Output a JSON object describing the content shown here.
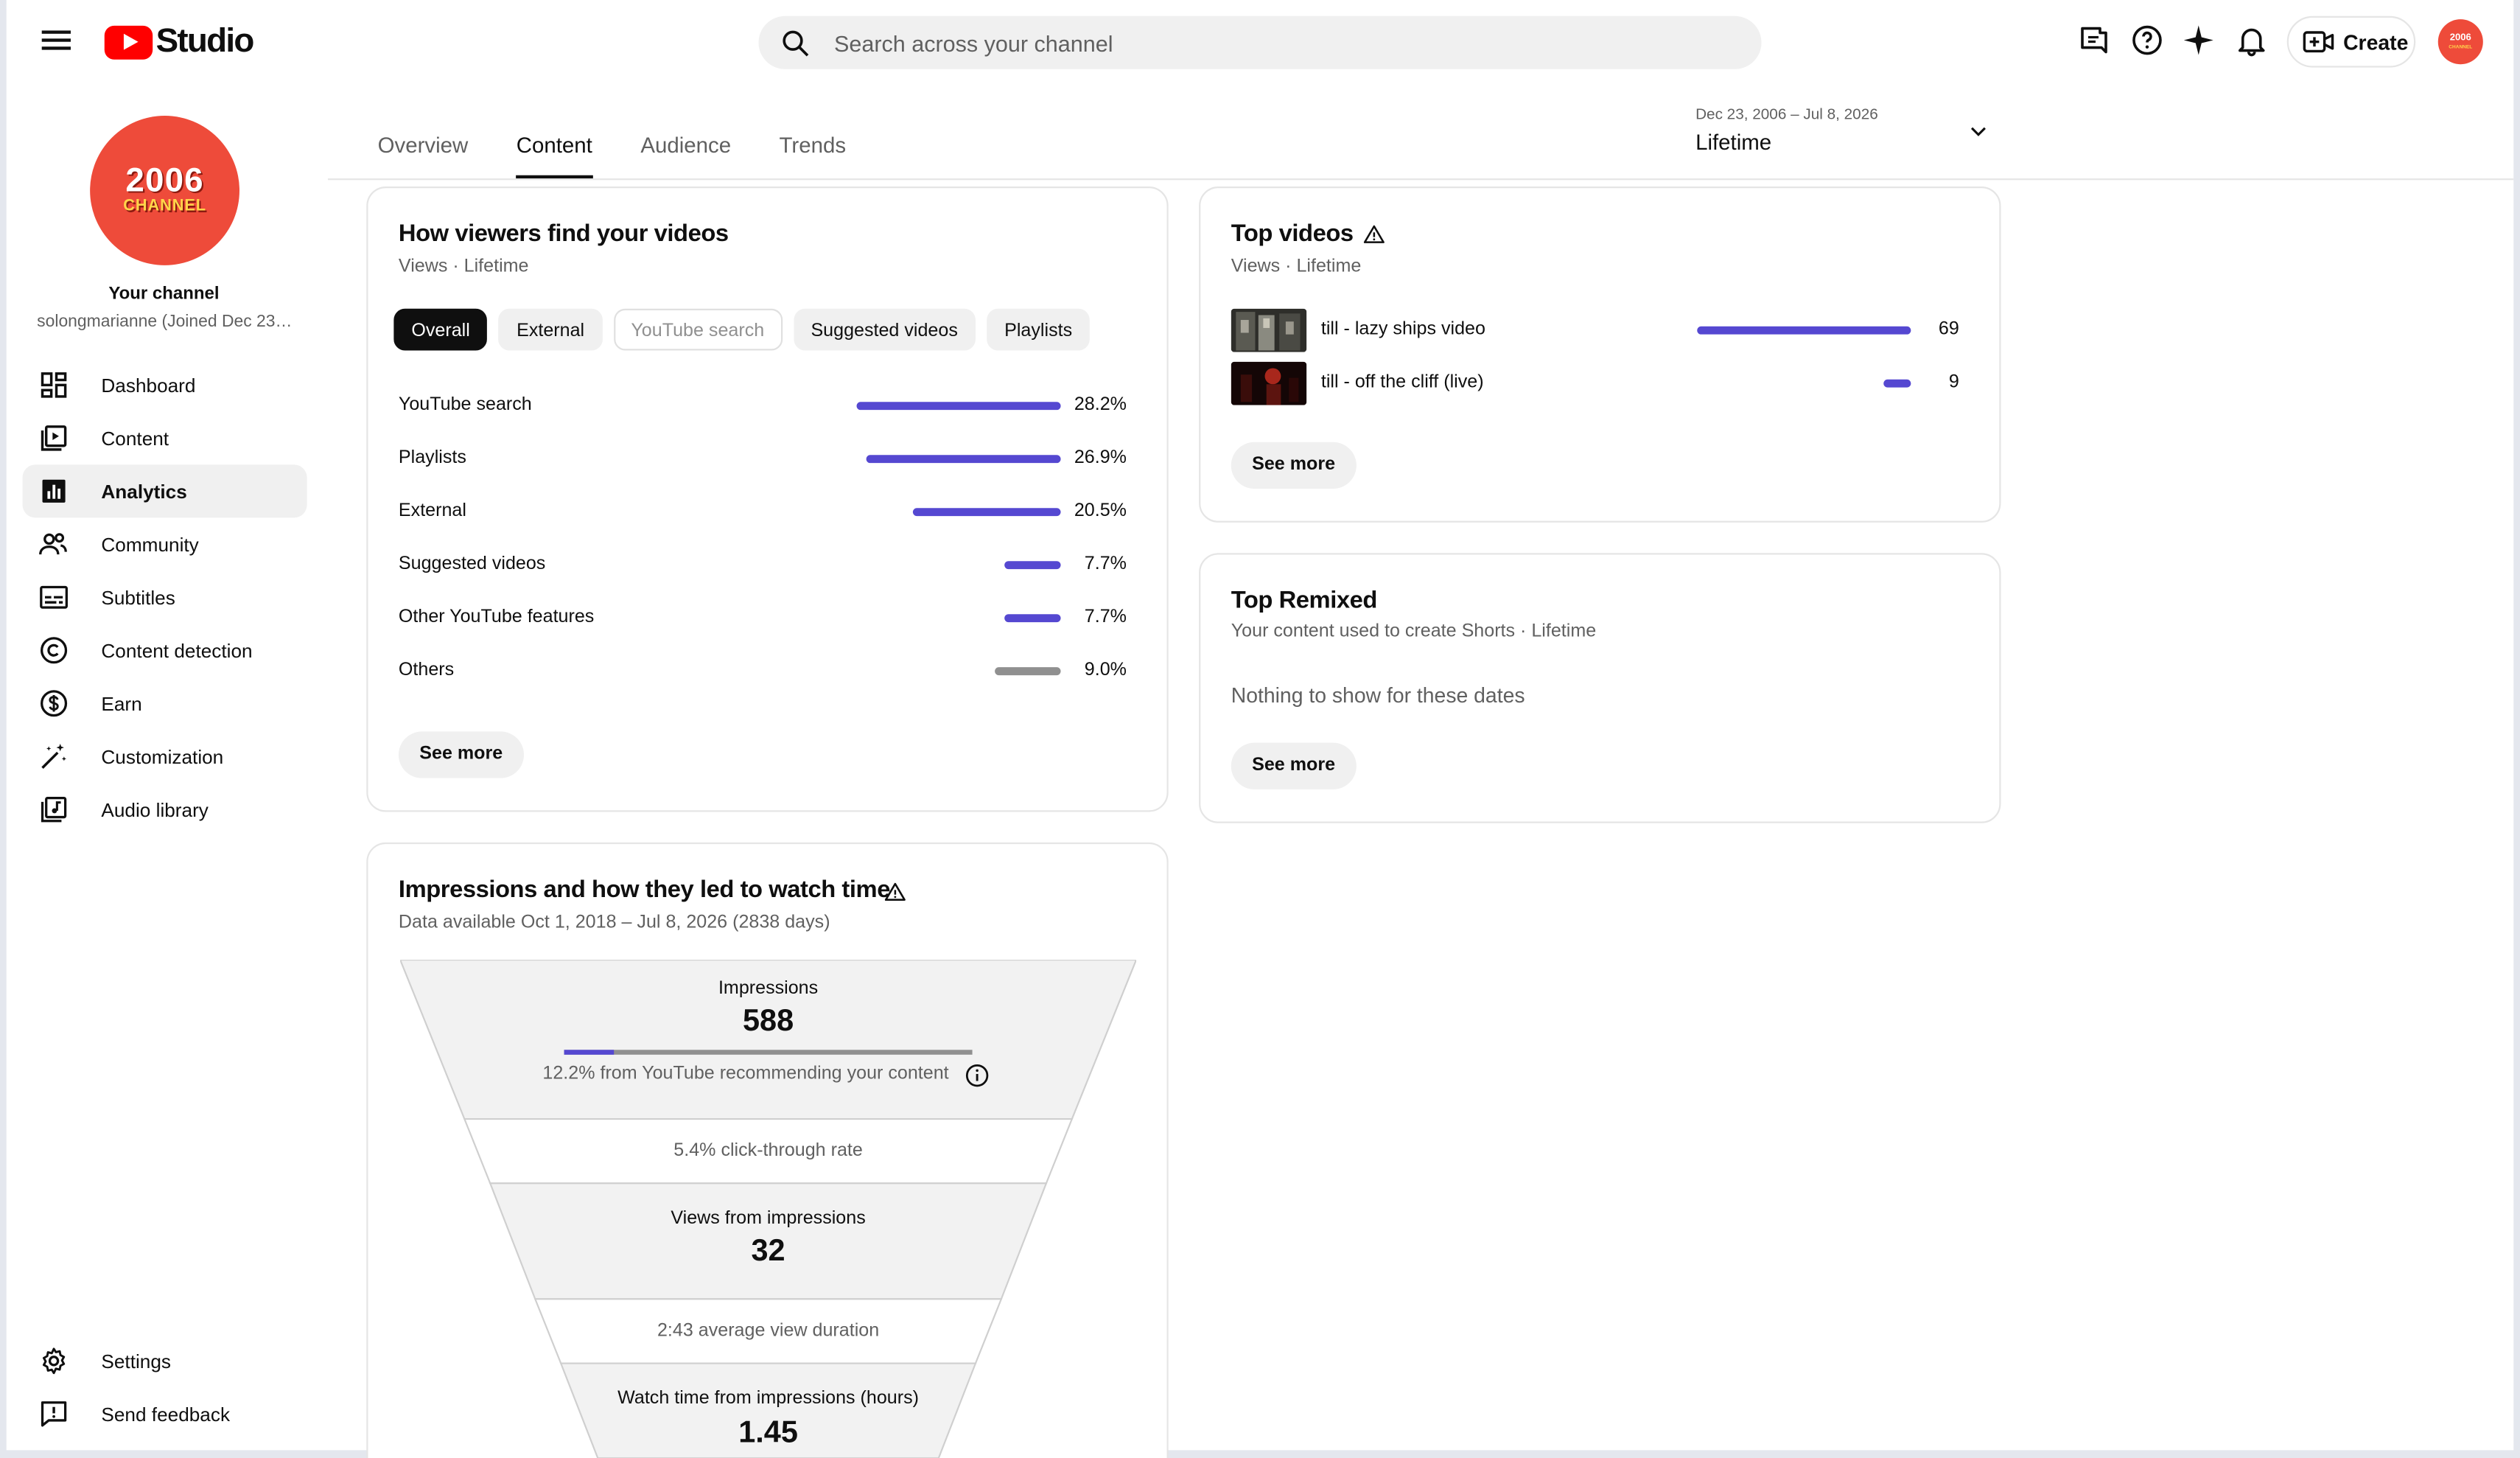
{
  "app": {
    "logo_text": "Studio"
  },
  "header": {
    "search_placeholder": "Search across your channel",
    "create_label": "Create"
  },
  "channel": {
    "avatar_line1": "2006",
    "avatar_line2": "CHANNEL",
    "title": "Your channel",
    "handle": "solongmarianne (Joined Dec 23, 2006)"
  },
  "sidebar": {
    "items": [
      {
        "label": "Dashboard",
        "icon": "dashboard-icon"
      },
      {
        "label": "Content",
        "icon": "content-icon"
      },
      {
        "label": "Analytics",
        "icon": "analytics-icon",
        "active": true
      },
      {
        "label": "Community",
        "icon": "community-icon"
      },
      {
        "label": "Subtitles",
        "icon": "subtitles-icon"
      },
      {
        "label": "Content detection",
        "icon": "copyright-icon"
      },
      {
        "label": "Earn",
        "icon": "dollar-icon"
      },
      {
        "label": "Customization",
        "icon": "magic-wand-icon"
      },
      {
        "label": "Audio library",
        "icon": "audio-library-icon"
      }
    ],
    "bottom": [
      {
        "label": "Settings",
        "icon": "gear-icon"
      },
      {
        "label": "Send feedback",
        "icon": "feedback-icon"
      }
    ]
  },
  "tabs": [
    {
      "label": "Overview"
    },
    {
      "label": "Content",
      "active": true
    },
    {
      "label": "Audience"
    },
    {
      "label": "Trends"
    }
  ],
  "date_range": {
    "range": "Dec 23, 2006 – Jul 8, 2026",
    "label": "Lifetime"
  },
  "traffic_card": {
    "title": "How viewers find your videos",
    "subtitle": "Views · Lifetime",
    "chips": [
      {
        "label": "Overall",
        "state": "selected"
      },
      {
        "label": "External",
        "state": "normal"
      },
      {
        "label": "YouTube search",
        "state": "disabled"
      },
      {
        "label": "Suggested videos",
        "state": "normal"
      },
      {
        "label": "Playlists",
        "state": "normal"
      }
    ],
    "sources": [
      {
        "label": "YouTube search",
        "value": "28.2%",
        "share": 28.2
      },
      {
        "label": "Playlists",
        "value": "26.9%",
        "share": 26.9
      },
      {
        "label": "External",
        "value": "20.5%",
        "share": 20.5
      },
      {
        "label": "Suggested videos",
        "value": "7.7%",
        "share": 7.7
      },
      {
        "label": "Other YouTube features",
        "value": "7.7%",
        "share": 7.7
      },
      {
        "label": "Others",
        "value": "9.0%",
        "share": 9.0,
        "color": "#909090"
      }
    ],
    "see_more": "See more",
    "bar_color": "#5548d1"
  },
  "top_videos": {
    "title": "Top videos",
    "subtitle": "Views · Lifetime",
    "videos": [
      {
        "title": "till - lazy ships video",
        "views": "69",
        "count": 69
      },
      {
        "title": "till - off the cliff (live)",
        "views": "9",
        "count": 9
      }
    ],
    "see_more": "See more"
  },
  "top_remixed": {
    "title": "Top Remixed",
    "subtitle": "Your content used to create Shorts · Lifetime",
    "empty_text": "Nothing to show for these dates",
    "see_more": "See more"
  },
  "funnel": {
    "title": "Impressions and how they led to watch time",
    "subtitle": "Data available Oct 1, 2018 – Jul 8, 2026 (2838 days)",
    "impressions_label": "Impressions",
    "impressions_value": "588",
    "recommend_text": "12.2% from YouTube recommending your content",
    "recommend_share": 12.2,
    "ctr_text": "5.4% click-through rate",
    "views_label": "Views from impressions",
    "views_value": "32",
    "avd_text": "2:43 average view duration",
    "watch_label": "Watch time from impressions (hours)",
    "watch_value": "1.45"
  },
  "colors": {
    "accent": "#5548d1",
    "brand": "#ff0000",
    "avatar": "#ee4b3a"
  }
}
